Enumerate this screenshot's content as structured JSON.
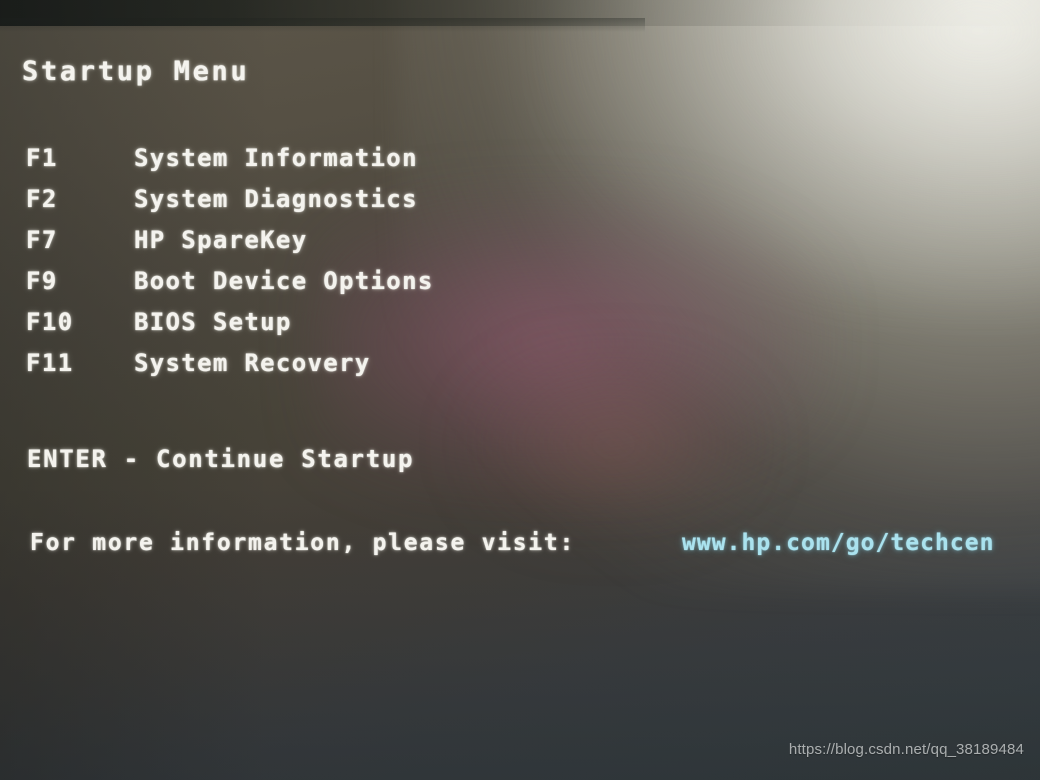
{
  "screen": {
    "title": "Startup Menu",
    "background_color": "#474338",
    "text_color": "#f4f3ee",
    "link_color": "#aae2ee"
  },
  "menu": {
    "items": [
      {
        "key": "F1",
        "label": "System Information"
      },
      {
        "key": "F2",
        "label": "System Diagnostics"
      },
      {
        "key": "F7",
        "label": "HP SpareKey"
      },
      {
        "key": "F9",
        "label": "Boot Device Options"
      },
      {
        "key": "F10",
        "label": "BIOS Setup"
      },
      {
        "key": "F11",
        "label": "System Recovery"
      }
    ]
  },
  "continue_hint": "ENTER - Continue Startup",
  "info": {
    "prompt": "For more information, please visit:",
    "url": "www.hp.com/go/techcen"
  },
  "watermark": "https://blog.csdn.net/qq_38189484"
}
